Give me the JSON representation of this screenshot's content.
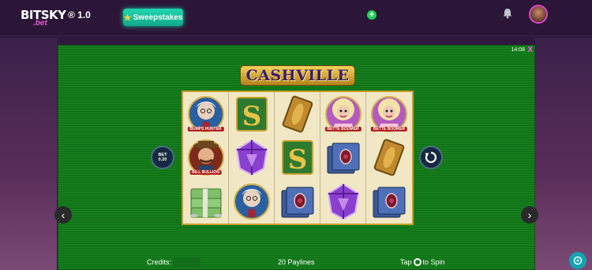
{
  "header": {
    "logo_text": "BITSKY",
    "logo_sub": ".bet",
    "version": "® 1.0",
    "sweep_label": "Sweepstakes",
    "plus_glyph": "+"
  },
  "game": {
    "title": "CASHVILLE",
    "clock": "14:08",
    "close_glyph": "X",
    "bet_label": "BET",
    "bet_value": "0.20",
    "credits_label": "Credits:",
    "paylines": "20 Paylines",
    "tap_prefix": "Tap",
    "tap_suffix": "to Spin",
    "reels": [
      [
        {
          "icon": "granny-symbol",
          "tag": "BUMPS HUNTER"
        },
        {
          "icon": "bill-bullion-symbol",
          "tag": "BILL BULLION"
        },
        {
          "icon": "cash-stack-symbol",
          "tag": ""
        }
      ],
      [
        {
          "icon": "dollar-symbol",
          "tag": ""
        },
        {
          "icon": "purple-jewel-symbol",
          "tag": ""
        },
        {
          "icon": "granny-symbol",
          "tag": ""
        }
      ],
      [
        {
          "icon": "gold-bar-symbol",
          "tag": ""
        },
        {
          "icon": "dollar-symbol",
          "tag": ""
        },
        {
          "icon": "blue-cards-symbol",
          "tag": ""
        }
      ],
      [
        {
          "icon": "betty-symbol",
          "tag": "BETTE BOOMER"
        },
        {
          "icon": "blue-cards-symbol",
          "tag": ""
        },
        {
          "icon": "purple-jewel-symbol",
          "tag": ""
        }
      ],
      [
        {
          "icon": "betty-symbol",
          "tag": "BETTE BOOMER"
        },
        {
          "icon": "gold-bar-symbol",
          "tag": ""
        },
        {
          "icon": "blue-cards-symbol",
          "tag": ""
        }
      ]
    ]
  },
  "nav": {
    "left_arrow": "‹",
    "right_arrow": "›"
  },
  "colors": {
    "accent": "#1fd6b0",
    "felt": "#157d1c",
    "magenta": "#d744c9"
  }
}
